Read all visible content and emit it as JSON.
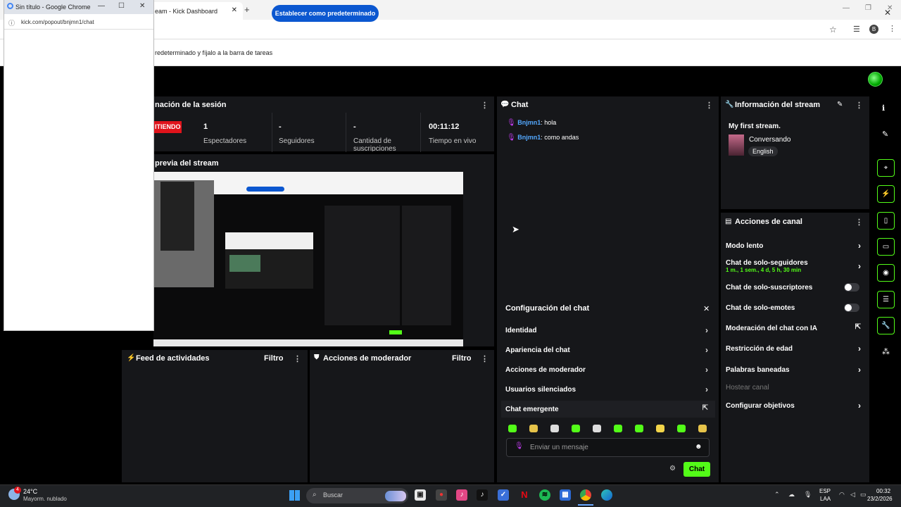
{
  "popup": {
    "title": "Sin título - Google Chrome",
    "url": "kick.com/popout/bnjmn1/chat"
  },
  "main_window": {
    "tab_title": "eam - Kick Dashboard",
    "infobar_text": "redeterminado y fíjalo a la barra de tareas",
    "set_default_button": "Establecer como predeterminado",
    "profile_initial": "B"
  },
  "session": {
    "title": "nación de la sesión",
    "live_label": "ITIENDO",
    "stats": [
      {
        "value": "1",
        "label": "Espectadores"
      },
      {
        "value": "-",
        "label": "Seguidores"
      },
      {
        "value": "-",
        "label": "Cantidad de suscripciones"
      },
      {
        "value": "00:11:12",
        "label": "Tiempo en vivo"
      }
    ]
  },
  "preview": {
    "title": "previa del stream"
  },
  "feed": {
    "title": "Feed de actividades",
    "filter": "Filtro"
  },
  "mod_actions": {
    "title": "Acciones de moderador",
    "filter": "Filtro"
  },
  "chat": {
    "title": "Chat",
    "messages": [
      {
        "user": "Bnjmn1",
        "text": ": hola"
      },
      {
        "user": "Bnjmn1",
        "text": ": como andas"
      }
    ],
    "settings": {
      "title": "Configuración del chat",
      "items": [
        "Identidad",
        "Apariencia del chat",
        "Acciones de moderador",
        "Usuarios silenciados",
        "Chat emergente"
      ]
    },
    "input_placeholder": "Enviar un mensaje",
    "send_label": "Chat"
  },
  "stream_info": {
    "title": "Información del stream",
    "stream_title": "My first stream.",
    "category": "Conversando",
    "language": "English"
  },
  "channel_actions": {
    "title": "Acciones de canal",
    "items": [
      {
        "label": "Modo lento",
        "sub": ""
      },
      {
        "label": "Chat de solo-seguidores",
        "sub": "1 m., 1 sem., 4 d, 5 h, 30 min"
      },
      {
        "label": "Chat de solo-suscriptores",
        "sub": ""
      },
      {
        "label": "Chat de solo-emotes",
        "sub": ""
      },
      {
        "label": "Moderación del chat con IA",
        "sub": ""
      },
      {
        "label": "Restricción de edad",
        "sub": ""
      },
      {
        "label": "Palabras baneadas",
        "sub": ""
      },
      {
        "label": "Hostear canal",
        "sub": ""
      },
      {
        "label": "Configurar objetivos",
        "sub": ""
      }
    ]
  },
  "taskbar": {
    "weather_temp": "24°C",
    "weather_desc": "Mayorm. nublado",
    "search_placeholder": "Buscar",
    "lang_top": "ESP",
    "lang_bottom": "LAA",
    "time": "00:32",
    "date": "23/2/2026",
    "notification_count": "4"
  },
  "colors": {
    "accent": "#53fc18",
    "live": "#e0131b",
    "username": "#53a8ff"
  }
}
